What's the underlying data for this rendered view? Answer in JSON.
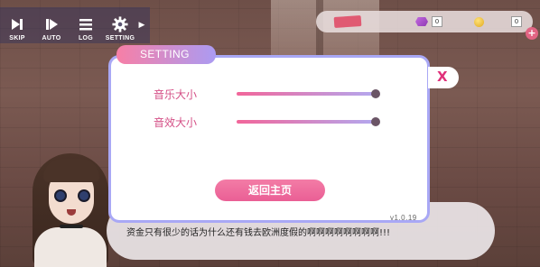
{
  "toolbar": {
    "items": [
      {
        "label": "SKIP",
        "icon": "skip-icon"
      },
      {
        "label": "AUTO",
        "icon": "auto-play-icon"
      },
      {
        "label": "LOG",
        "icon": "log-list-icon"
      },
      {
        "label": "SETTING",
        "icon": "gear-icon"
      }
    ],
    "more_icon": "chevron-right-icon"
  },
  "resources": {
    "ticket_value": "",
    "gem_value": "0",
    "coin_value": "0"
  },
  "settings": {
    "title": "SETTING",
    "close_label": "X",
    "music_label": "音乐大小",
    "music_level": 1.0,
    "sfx_label": "音效大小",
    "sfx_level": 1.0,
    "back_label": "返回主页",
    "version": "v1.0.19"
  },
  "dialog": {
    "text": "资金只有很少的话为什么还有钱去欧洲度假的啊啊啊啊啊啊啊啊!!!"
  },
  "colors": {
    "accent_pink": "#e9609a",
    "accent_purple": "#aba7f3"
  }
}
